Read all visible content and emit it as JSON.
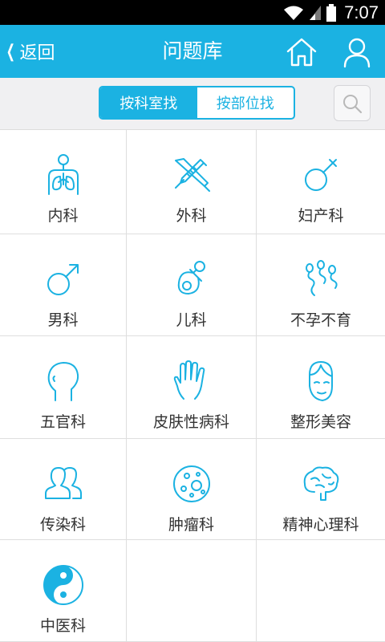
{
  "status": {
    "time": "7:07"
  },
  "nav": {
    "back_label": "返回",
    "title": "问题库"
  },
  "tabs": [
    {
      "label": "按科室找",
      "active": true
    },
    {
      "label": "按部位找",
      "active": false
    }
  ],
  "accent_color": "#1bb2e2",
  "departments": [
    {
      "label": "内科",
      "icon": "lungs-icon"
    },
    {
      "label": "外科",
      "icon": "scalpel-syringe-icon"
    },
    {
      "label": "妇产科",
      "icon": "female-symbol-icon"
    },
    {
      "label": "男科",
      "icon": "male-symbol-icon"
    },
    {
      "label": "儿科",
      "icon": "pacifier-icon"
    },
    {
      "label": "不孕不育",
      "icon": "sperm-icon"
    },
    {
      "label": "五官科",
      "icon": "head-profile-icon"
    },
    {
      "label": "皮肤性病科",
      "icon": "hand-icon"
    },
    {
      "label": "整形美容",
      "icon": "face-icon"
    },
    {
      "label": "传染科",
      "icon": "people-icon"
    },
    {
      "label": "肿瘤科",
      "icon": "cell-icon"
    },
    {
      "label": "精神心理科",
      "icon": "brain-icon"
    },
    {
      "label": "中医科",
      "icon": "yin-yang-icon"
    }
  ]
}
